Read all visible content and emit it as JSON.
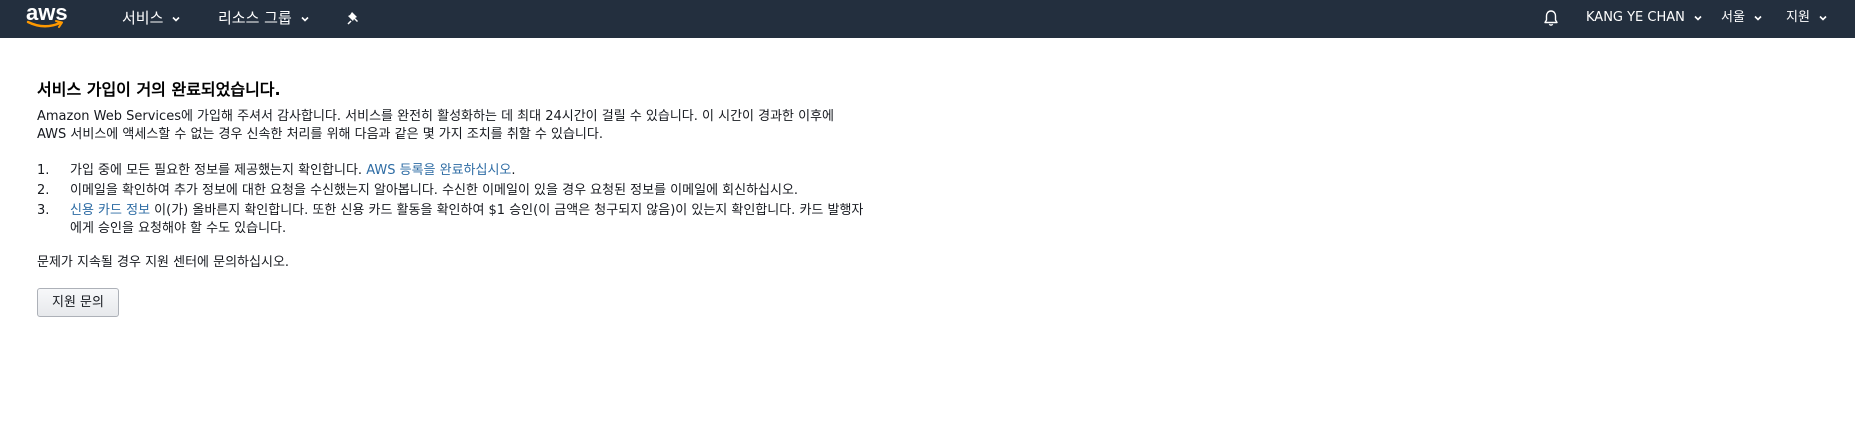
{
  "header": {
    "logo_text": "aws",
    "services_label": "서비스",
    "resource_groups_label": "리소스 그룹",
    "user_label": "KANG YE CHAN",
    "region_label": "서울",
    "support_label": "지원",
    "colors": {
      "background": "#232f3e",
      "logo_smile": "#ff9900"
    }
  },
  "main": {
    "title": "서비스 가입이 거의 완료되었습니다.",
    "intro": "Amazon Web Services에 가입해 주셔서 감사합니다. 서비스를 완전히 활성화하는 데 최대 24시간이 걸릴 수 있습니다. 이 시간이 경과한 이후에 AWS 서비스에 액세스할 수 없는 경우 신속한 처리를 위해 다음과 같은 몇 가지 조치를 취할 수 있습니다.",
    "steps": [
      {
        "num": "1.",
        "text_before": "가입 중에 모든 필요한 정보를 제공했는지 확인합니다. ",
        "link": "AWS 등록을 완료하십시오",
        "text_after": "."
      },
      {
        "num": "2.",
        "text": "이메일을 확인하여 추가 정보에 대한 요청을 수신했는지 알아봅니다. 수신한 이메일이 있을 경우 요청된 정보를 이메일에 회신하십시오."
      },
      {
        "num": "3.",
        "link": "신용 카드 정보",
        "text_after": " 이(가) 올바른지 확인합니다. 또한 신용 카드 활동을 확인하여 $1 승인(이 금액은 청구되지 않음)이 있는지 확인합니다. 카드 발행자에게 승인을 요청해야 할 수도 있습니다."
      }
    ],
    "final": "문제가 지속될 경우 지원 센터에 문의하십시오.",
    "support_button": "지원 문의",
    "link_color": "#2e6ca4"
  }
}
